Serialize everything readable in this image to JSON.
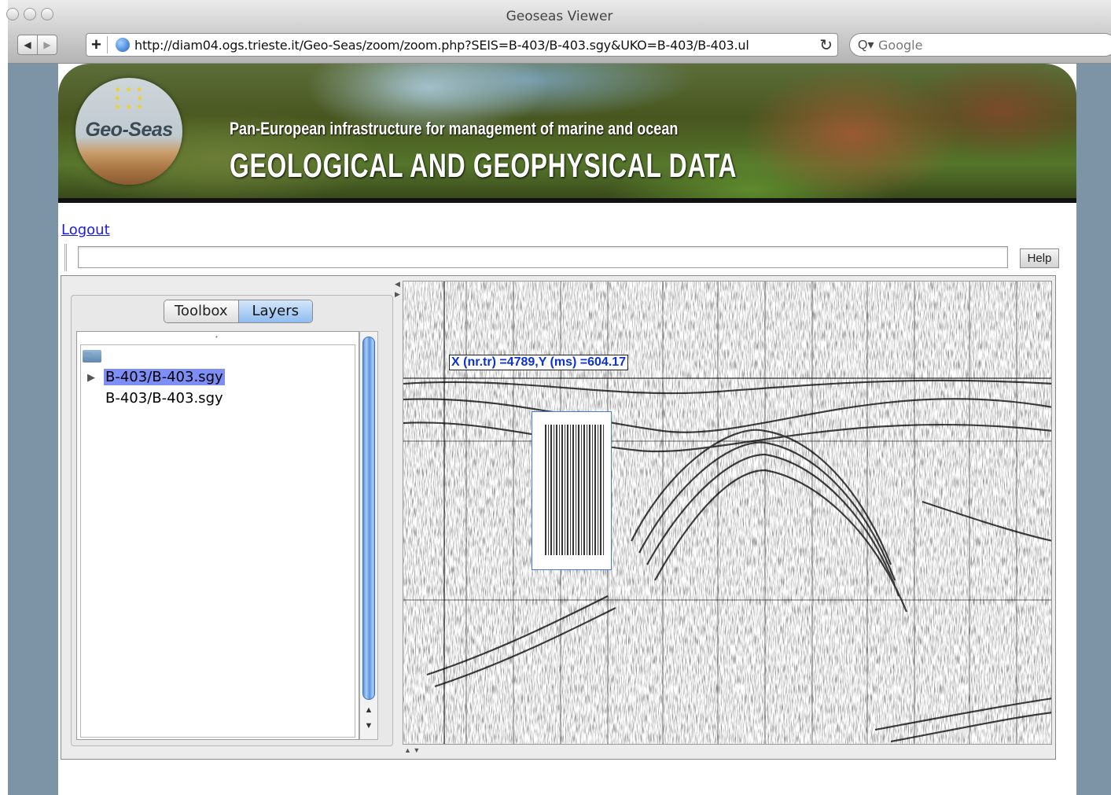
{
  "window": {
    "title": "Geoseas Viewer"
  },
  "toolbar": {
    "back_label": "◀",
    "forward_label": "▶",
    "url": "http://diam04.ogs.trieste.it/Geo-Seas/zoom/zoom.php?SEIS=B-403/B-403.sgy&UKO=B-403/B-403.ul",
    "search_placeholder": "Google"
  },
  "banner": {
    "logo_text": "Geo-Seas",
    "subtitle": "Pan-European infrastructure for management of marine and ocean",
    "title": "GEOLOGICAL AND GEOPHYSICAL DATA"
  },
  "page": {
    "logout_label": "Logout",
    "input_value": "",
    "help_label": "Help"
  },
  "applet": {
    "tabs": [
      {
        "label": "Toolbox",
        "active": false
      },
      {
        "label": "Layers",
        "active": true
      }
    ],
    "tree": [
      {
        "label": "B-403/B-403.sgy",
        "selected": true
      },
      {
        "label": "B-403/B-403.sgy",
        "selected": false
      }
    ],
    "coordinate_readout": "X (nr.tr) =4789,Y (ms) =604.17"
  },
  "colors": {
    "selection": "#7e8ef7",
    "readout_text": "#0a32d6",
    "frame_bg": "#7c94a5"
  }
}
